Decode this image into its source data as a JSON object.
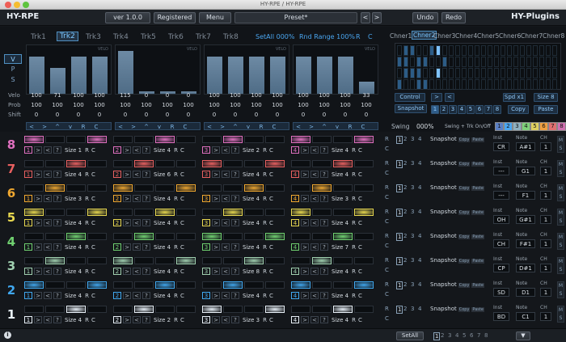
{
  "window": {
    "title": "HY-RPE / HY-RPE"
  },
  "header": {
    "brand_left": "HY-RPE",
    "version": "ver 1.0.0",
    "registered": "Registered",
    "menu": "Menu",
    "preset": "Preset*",
    "prev": "<",
    "next": ">",
    "undo": "Undo",
    "redo": "Redo",
    "brand_right": "HY-Plugins"
  },
  "tracks": {
    "tabs": [
      "Trk1",
      "Trk2",
      "Trk3",
      "Trk4",
      "Trk5",
      "Trk6",
      "Trk7",
      "Trk8"
    ],
    "selected": 1,
    "set_all": "SetAll 000%",
    "rnd_range": "Rnd Range 100%",
    "r": "R",
    "c": "C"
  },
  "modes": [
    "V",
    "P",
    "S"
  ],
  "row_labels": {
    "velo": "Velo",
    "prob": "Prob",
    "shift": "Shift",
    "bar_tag": "VELO"
  },
  "steps": {
    "velo": [
      100,
      71,
      100,
      100,
      115,
      0,
      0,
      0,
      100,
      100,
      100,
      100,
      100,
      100,
      100,
      33
    ],
    "prob": [
      100,
      100,
      100,
      100,
      100,
      100,
      100,
      100,
      100,
      100,
      100,
      100,
      100,
      100,
      100,
      100
    ],
    "shift": [
      0,
      0,
      0,
      0,
      0,
      0,
      0,
      0,
      0,
      0,
      0,
      0,
      0,
      0,
      0,
      0
    ]
  },
  "arrows": [
    "<",
    ">",
    "^",
    "v",
    "R",
    "C"
  ],
  "chaser": {
    "tabs": [
      "Chner1",
      "Chner2",
      "Chner3",
      "Chner4",
      "Chner5",
      "Chner6",
      "Chner7",
      "Chner8"
    ],
    "selected": 1,
    "control": "Control",
    "snapshot": "Snapshot",
    "spd": "Spd x1",
    "size": "Size 8",
    "copy": "Copy",
    "paste": "Paste",
    "snap_numbers": [
      "1",
      "2",
      "3",
      "4",
      "5",
      "6",
      "7",
      "8"
    ]
  },
  "swing": {
    "label": "Swing",
    "value": "000%",
    "trk_label": "Swing + Trk On/Off",
    "boxes": [
      "1",
      "2",
      "3",
      "4",
      "5",
      "6",
      "7",
      "8"
    ],
    "colors": [
      "#5a7fc4",
      "#4aa6f0",
      "#8fb0c0",
      "#7fd07a",
      "#e0d060",
      "#f0a040",
      "#e07070",
      "#d070b0"
    ]
  },
  "rows": [
    {
      "num": "8",
      "color": "#e070c0",
      "sizes": [
        "Size 1",
        "Size 4",
        "Size 2",
        "Size 4"
      ],
      "inst": "CR",
      "note": "A#1",
      "ch": "1"
    },
    {
      "num": "7",
      "color": "#e86060",
      "sizes": [
        "Size 4",
        "Size 6",
        "Size 4",
        "Size 4"
      ],
      "inst": "---",
      "note": "G1",
      "ch": "1"
    },
    {
      "num": "6",
      "color": "#f0a830",
      "sizes": [
        "Size 3",
        "Size 4",
        "Size 4",
        "Size 3"
      ],
      "inst": "---",
      "note": "F1",
      "ch": "1"
    },
    {
      "num": "5",
      "color": "#e8d850",
      "sizes": [
        "Size 4",
        "Size 4",
        "Size 4",
        "Size 4"
      ],
      "inst": "OH",
      "note": "G#1",
      "ch": "1"
    },
    {
      "num": "4",
      "color": "#70d070",
      "sizes": [
        "Size 4",
        "Size 4",
        "Size 4",
        "Size 7"
      ],
      "inst": "CH",
      "note": "F#1",
      "ch": "1"
    },
    {
      "num": "3",
      "color": "#a0d0b0",
      "sizes": [
        "Size 4",
        "Size 4",
        "Size 8",
        "Size 4"
      ],
      "inst": "CP",
      "note": "D#1",
      "ch": "1"
    },
    {
      "num": "2",
      "color": "#40a8f0",
      "sizes": [
        "Size 4",
        "Size 4",
        "Size 4",
        "Size 4"
      ],
      "inst": "SD",
      "note": "D1",
      "ch": "1"
    },
    {
      "num": "1",
      "color": "#e8f0f8",
      "sizes": [
        "Size 4",
        "Size 2",
        "Size 3",
        "Size 4"
      ],
      "inst": "BD",
      "note": "C1",
      "ch": "1"
    }
  ],
  "row_labels_right": {
    "snapshot": "Snapshot",
    "copy": "Copy",
    "paste": "Paste",
    "inst": "Inst",
    "note": "Note",
    "ch": "CH",
    "m": "M",
    "s": "S",
    "r": "R",
    "c": "C"
  },
  "footer": {
    "setall": "SetAll",
    "pages": [
      "1",
      "2",
      "3",
      "4",
      "5",
      "6",
      "7",
      "8"
    ],
    "info": "i",
    "down": "▼"
  }
}
